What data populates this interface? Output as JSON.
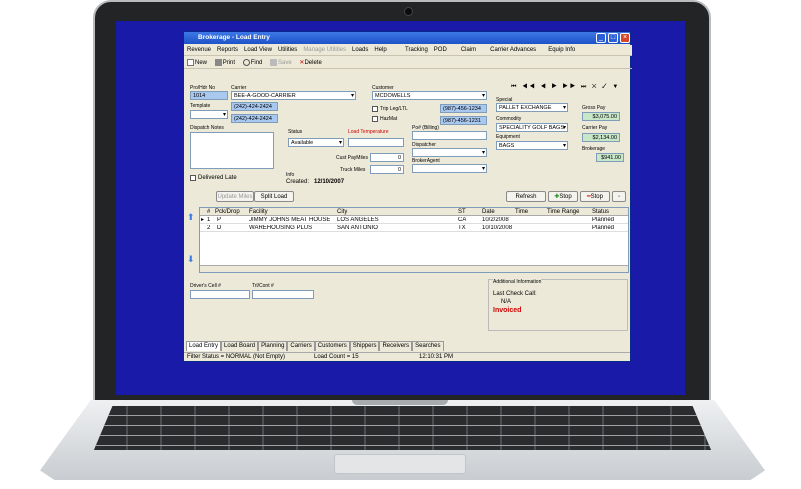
{
  "window": {
    "title": "Brokerage - Load Entry"
  },
  "menu": [
    "Revenue",
    "Reports",
    "Load View",
    "Utilities",
    "Manage Utilities",
    "Loads",
    "Help"
  ],
  "menu2": [
    "Tracking",
    "POD",
    "Claim",
    "Carrier Advances",
    "Equip Info"
  ],
  "toolbar": {
    "new": "New",
    "print": "Print",
    "find": "Find",
    "save": "Save",
    "delete": "Delete"
  },
  "form": {
    "pro_label": "Pro/Hdr No",
    "pro_value": "1014",
    "template_label": "Template",
    "carrier_label": "Carrier",
    "carrier_value": "BEE-A-GOOD-CARRIER",
    "carrier_phone1": "(242)-424-2424",
    "carrier_phone2": "(242)-424-2424",
    "customer_label": "Customer",
    "customer_value": "MCDOWELLS",
    "trip_leg_label": "Trip Leg/LTL",
    "hazmat_label": "HazMat",
    "cust_phone1": "(987)-456-1234",
    "cust_phone2": "(987)-456-1231",
    "special_label": "Special",
    "special_value": "PALLET EXCHANGE",
    "commodity_label": "Commodity",
    "commodity_value": "SPECIALITY GOLF BAGS",
    "equipment_label": "Equipment",
    "equipment_value": "BAGS",
    "gross_pay_label": "Gross Pay",
    "gross_pay_value": "$3,075.00",
    "carrier_pay_label": "Carrier Pay",
    "carrier_pay_value": "$2,134.00",
    "brokerage_label": "Brokerage",
    "brokerage_value": "$941.00",
    "dispatch_notes_label": "Dispatch Notes",
    "status_label": "Status",
    "status_value": "Available",
    "load_temp_label": "Load Temperature",
    "po_label": "Po# (Billing)",
    "dispatcher_label": "Dispatcher",
    "broker_agent_label": "BrokerAgent",
    "cust_pay_miles_label": "Cust PayMiles",
    "cust_pay_miles_value": "0",
    "truck_miles_label": "Truck Miles",
    "truck_miles_value": "0",
    "info_label": "Info",
    "created_label": "Created:",
    "created_value": "12/10/2007",
    "delivered_late_label": "Delivered Late"
  },
  "buttons": {
    "update_miles": "Update Miles",
    "split_load": "Split Load",
    "refresh": "Refresh",
    "add_stop": "Stop",
    "remove_stop": "Stop"
  },
  "stops": {
    "headers": [
      "#",
      "Pck/Drop",
      "Facility",
      "City",
      "ST",
      "Date",
      "Time",
      "Time Range",
      "Status"
    ],
    "rows": [
      [
        "1",
        "P",
        "JIMMY JOHNS MEAT HOUSE",
        "LOS ANGELES",
        "CA",
        "10/2/2008",
        "",
        "",
        "Planned"
      ],
      [
        "2",
        "D",
        "WAREHOUSING PLUS",
        "SAN ANTONIO",
        "TX",
        "10/10/2008",
        "",
        "",
        "Planned"
      ]
    ]
  },
  "bottom": {
    "drivers_cell_label": "Driver's Cell #",
    "trl_cont_label": "Trl/Cont #",
    "additional_info_label": "Additional Information",
    "last_check_call_label": "Last Check Call:",
    "last_check_call_value": "N/A",
    "invoiced": "Invoiced"
  },
  "tabs": [
    "Load Entry",
    "Load Board",
    "Planning",
    "Carriers",
    "Customers",
    "Shippers",
    "Receivers",
    "Searches"
  ],
  "statusbar": {
    "filter": "Filter Status = NORMAL (Not Empty)",
    "count": "Load Count = 15",
    "time": "12:10:31 PM"
  },
  "colors": {
    "titlebar": "#1d52c8",
    "desktop": "#1a1aa8",
    "invoiced": "#d00000",
    "pay_field": "#c8e6c8",
    "phone_field": "#a8c8f0"
  }
}
